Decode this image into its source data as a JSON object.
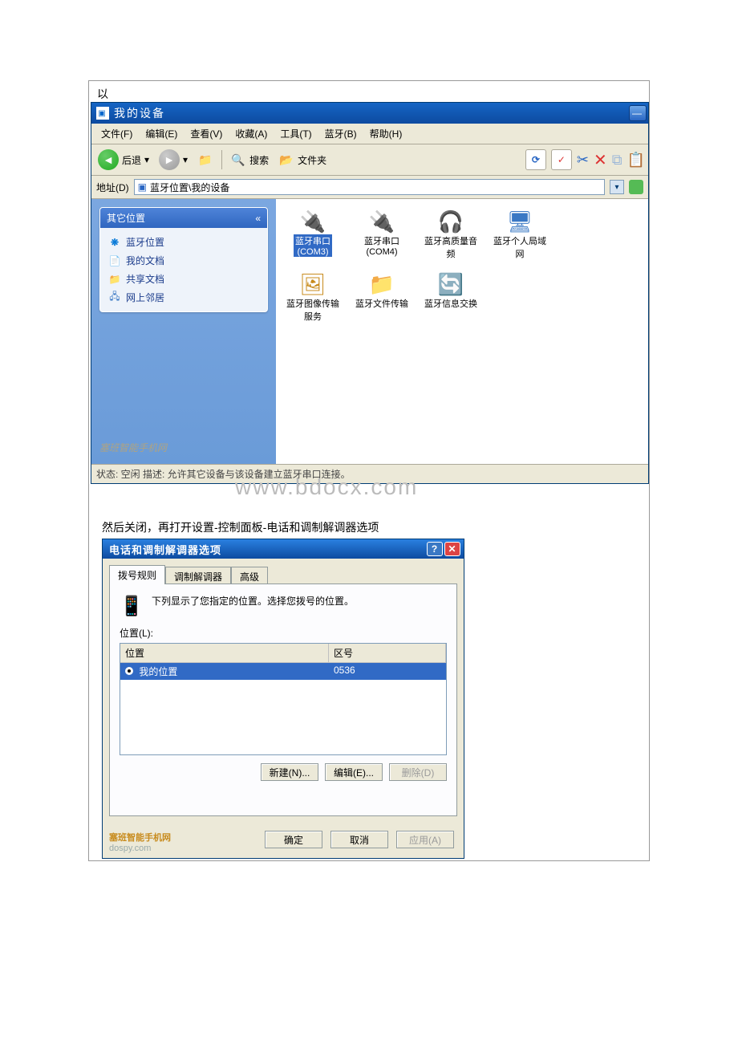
{
  "pre_text": "以",
  "explorer": {
    "title": "我的设备",
    "menu": {
      "file": "文件(F)",
      "edit": "编辑(E)",
      "view": "查看(V)",
      "fav": "收藏(A)",
      "tools": "工具(T)",
      "bluetooth": "蓝牙(B)",
      "help": "帮助(H)"
    },
    "toolbar": {
      "back": "后退",
      "search": "搜索",
      "folders": "文件夹"
    },
    "address": {
      "label": "地址(D)",
      "value": "蓝牙位置\\我的设备"
    },
    "side": {
      "header": "其它位置",
      "items": [
        {
          "label": "蓝牙位置"
        },
        {
          "label": "我的文档"
        },
        {
          "label": "共享文档"
        },
        {
          "label": "网上邻居"
        }
      ],
      "watermark": "塞班智能手机网"
    },
    "icons": [
      {
        "label": "蓝牙串口",
        "sub": "(COM3)",
        "selected": true
      },
      {
        "label": "蓝牙串口",
        "sub": "(COM4)",
        "selected": false
      },
      {
        "label": "蓝牙高质量音频",
        "sub": "",
        "selected": false
      },
      {
        "label": "蓝牙个人局域网",
        "sub": "",
        "selected": false
      },
      {
        "label": "蓝牙图像传输服务",
        "sub": "",
        "selected": false
      },
      {
        "label": "蓝牙文件传输",
        "sub": "",
        "selected": false
      },
      {
        "label": "蓝牙信息交换",
        "sub": "",
        "selected": false
      }
    ],
    "status": "状态: 空闲 描述: 允许其它设备与该设备建立蓝牙串口连接。"
  },
  "overlay_wm": "www.bdocx.com",
  "instruction": "然后关闭，再打开设置-控制面板-电话和调制解调器选项",
  "dialog": {
    "title": "电话和调制解调器选项",
    "tabs": {
      "dial": "拨号规则",
      "modem": "调制解调器",
      "adv": "高级"
    },
    "hint": "下列显示了您指定的位置。选择您拨号的位置。",
    "loc_label": "位置(L):",
    "columns": {
      "loc": "位置",
      "code": "区号"
    },
    "rows": [
      {
        "loc": "我的位置",
        "code": "0536"
      }
    ],
    "buttons": {
      "new": "新建(N)...",
      "edit": "编辑(E)...",
      "del": "删除(D)",
      "ok": "确定",
      "cancel": "取消",
      "apply": "应用(A)"
    },
    "brand1": "塞班智能手机网",
    "brand2": "dospy.com"
  }
}
